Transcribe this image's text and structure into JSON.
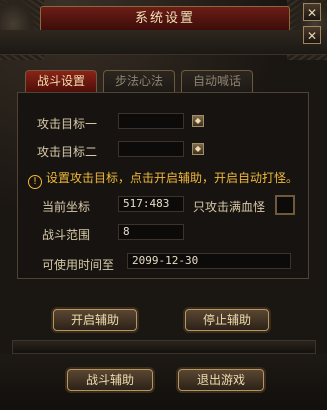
{
  "window": {
    "title": "系统设置",
    "close_glyph": "✕"
  },
  "tabs": [
    {
      "label": "战斗设置",
      "active": true
    },
    {
      "label": "步法心法",
      "active": false
    },
    {
      "label": "自动喊话",
      "active": false
    }
  ],
  "form": {
    "target1_label": "攻击目标一",
    "target1_value": "",
    "target2_label": "攻击目标二",
    "target2_value": "",
    "notice": "设置攻击目标，点击开启辅助，开启自动打怪。",
    "coord_label": "当前坐标",
    "coord_value": "517:483",
    "full_hp_label": "只攻击满血怪",
    "range_label": "战斗范围",
    "range_value": "8",
    "expire_label": "可使用时间至",
    "expire_value": "2099-12-30"
  },
  "buttons": {
    "start_assist": "开启辅助",
    "stop_assist": "停止辅助",
    "battle_assist": "战斗辅助",
    "exit_game": "退出游戏"
  },
  "colors": {
    "accent_red": "#8a2418",
    "notice_yellow": "#f0b93a",
    "gold_border": "#b8965f"
  }
}
